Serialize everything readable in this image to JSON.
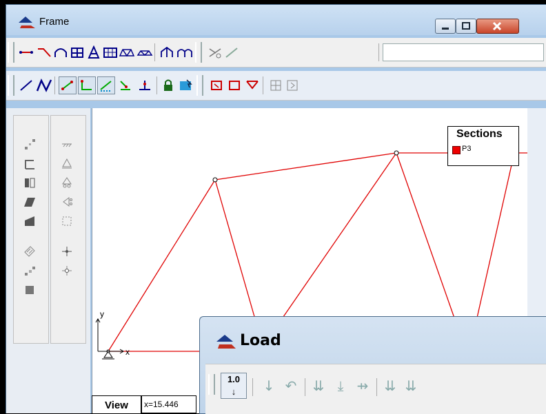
{
  "frame_window": {
    "title": "Frame"
  },
  "section_combo": {
    "value": ""
  },
  "legend": {
    "title": "Sections",
    "items": [
      {
        "label": "P3",
        "color": "#e00000"
      }
    ]
  },
  "axes": {
    "x_label": "x",
    "y_label": "y"
  },
  "status": {
    "view_label": "View",
    "coordinate": "x=15.446"
  },
  "load_window": {
    "title": "Load",
    "step_value": "1.0",
    "step_arrow": "↓"
  },
  "colors": {
    "member": "#e00000",
    "canvas": "#ffffff",
    "titlebar": "#c4daf0"
  }
}
